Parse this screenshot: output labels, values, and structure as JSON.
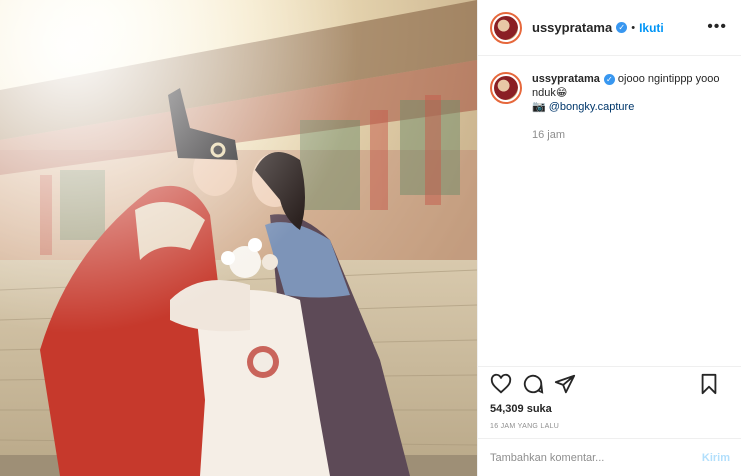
{
  "post": {
    "username": "ussypratama",
    "follow_label": "Ikuti",
    "dot": "•",
    "more_label": "•••",
    "verified_mark": "✓",
    "caption_user": "ussypratama",
    "caption_text": " ojooo ngintippp yooo nduk😁",
    "caption_camera": "📷",
    "caption_mention": "@bongky.capture",
    "caption_time": "16 jam",
    "likes": "54,309 suka",
    "time_ago": "16 JAM YANG LALU",
    "comment_placeholder": "Tambahkan komentar...",
    "post_button": "Kirim"
  },
  "icons": {
    "like": "heart-icon",
    "comment": "comment-icon",
    "share": "share-icon",
    "save": "bookmark-icon",
    "verified": "verified-badge-icon",
    "more": "more-options-icon"
  },
  "colors": {
    "accent": "#0095f6",
    "verified": "#3897f0",
    "muted": "#8e8e8e",
    "post_disabled": "#b2dffc"
  }
}
